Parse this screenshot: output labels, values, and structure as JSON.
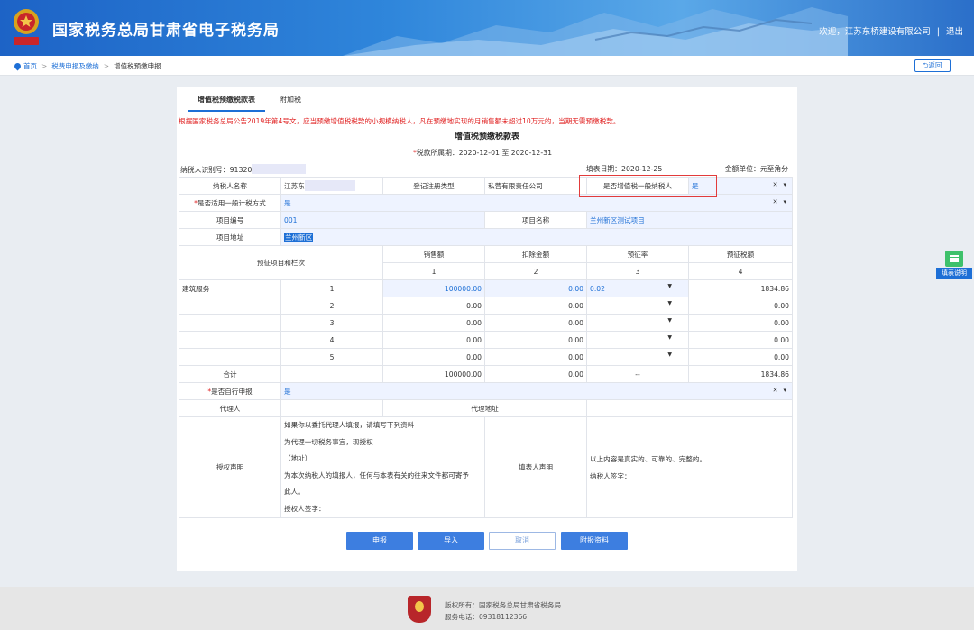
{
  "header": {
    "site_title": "国家税务总局甘肃省电子税务局",
    "welcome": "欢迎，江苏东桥建设有限公司",
    "separator": "|",
    "logout": "退出",
    "emblem_caption": "中国税务"
  },
  "breadcrumb": {
    "home": "首页",
    "level1": "税费申报及缴纳",
    "level2": "增值税预缴申报",
    "back_button": "返回"
  },
  "tabs": [
    "增值税预缴税款表",
    "附加税"
  ],
  "notice": "根据国家税务总局公告2019年第4号文，应当预缴增值税税款的小规模纳税人，凡在预缴地实现的月销售额未超过10万元的，当期无需预缴税款。",
  "form": {
    "title": "增值税预缴税款表",
    "period_label": "税款所属期：",
    "period_value": "2020-12-01 至 2020-12-31",
    "taxpayer_id_label": "纳税人识别号：",
    "taxpayer_id_value": "91320",
    "fill_date_label": "填表日期：",
    "fill_date_value": "2020-12-25",
    "unit_label": "金额单位：",
    "unit_value": "元至角分",
    "name_label": "纳税人名称",
    "name_value": "江苏东",
    "reg_type_label": "登记注册类型",
    "reg_type_value": "私营有限责任公司",
    "general_taxpayer_label": "是否增值税一般纳税人",
    "general_taxpayer_value": "是",
    "general_method_label": "是否适用一般计税方式",
    "general_method_value": "是",
    "project_no_label": "项目编号",
    "project_no_value": "001",
    "project_name_label": "项目名称",
    "project_name_value": "兰州新区测试项目",
    "project_addr_label": "项目地址",
    "project_addr_value": "兰州新区",
    "items_label": "预征项目和栏次",
    "col_headers": [
      "销售额",
      "扣除金额",
      "预征率",
      "预征税额"
    ],
    "col_numbers": [
      "1",
      "2",
      "3",
      "4"
    ],
    "rows": [
      {
        "item": "建筑服务",
        "no": "1",
        "sales": "100000.00",
        "deduct": "0.00",
        "rate": "0.02",
        "tax": "1834.86"
      },
      {
        "item": "",
        "no": "2",
        "sales": "0.00",
        "deduct": "0.00",
        "rate": "",
        "tax": "0.00"
      },
      {
        "item": "",
        "no": "3",
        "sales": "0.00",
        "deduct": "0.00",
        "rate": "",
        "tax": "0.00"
      },
      {
        "item": "",
        "no": "4",
        "sales": "0.00",
        "deduct": "0.00",
        "rate": "",
        "tax": "0.00"
      },
      {
        "item": "",
        "no": "5",
        "sales": "0.00",
        "deduct": "0.00",
        "rate": "",
        "tax": "0.00"
      }
    ],
    "total": {
      "label": "合计",
      "sales": "100000.00",
      "deduct": "0.00",
      "rate": "--",
      "tax": "1834.86"
    },
    "self_declare_label": "是否自行申报",
    "self_declare_value": "是",
    "agent_label": "代理人",
    "agent_addr_label": "代理地址",
    "auth_label": "授权声明",
    "auth_lines": [
      "如果你以委托代理人填报，请填写下列资料",
      "为代理一切税务事宜，现授权",
      "（地址）",
      "为本次纳税人的填报人，任何与本表有关的往来文件都可寄予",
      "此人。",
      "授权人签字："
    ],
    "filler_label": "填表人声明",
    "filler_lines": [
      "以上内容是真实的、可靠的、完整的。",
      "纳税人签字："
    ]
  },
  "buttons": {
    "submit": "申报",
    "import": "导入",
    "cancel": "取消",
    "attach": "附报资料"
  },
  "side_help": "填表说明",
  "footer": {
    "copyright": "版权所有：国家税务总局甘肃省税务局",
    "phone": "服务电话：09318112366"
  }
}
